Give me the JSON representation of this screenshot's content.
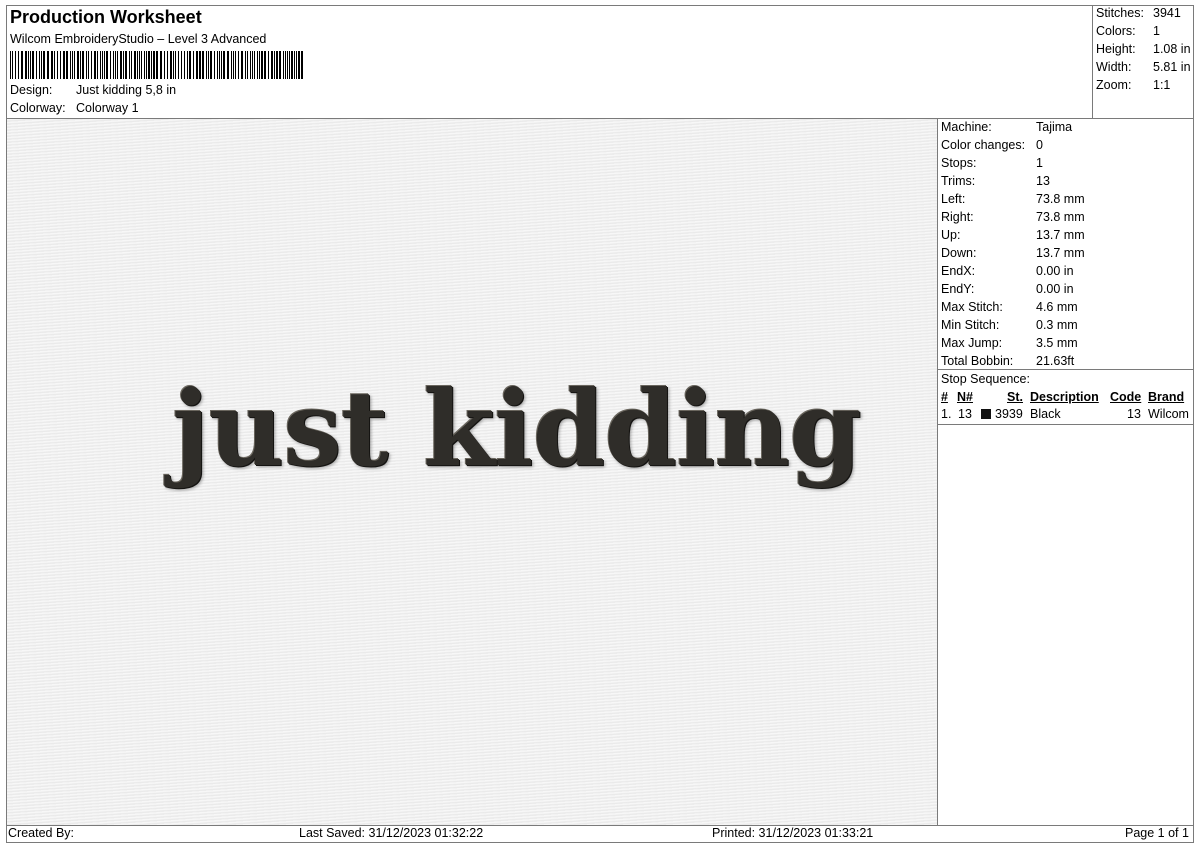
{
  "header": {
    "title": "Production Worksheet",
    "software": "Wilcom EmbroideryStudio – Level 3 Advanced",
    "design_label": "Design:",
    "design_value": "Just kidding 5,8 in",
    "colorway_label": "Colorway:",
    "colorway_value": "Colorway 1"
  },
  "summary": [
    {
      "label": "Stitches:",
      "value": "3941"
    },
    {
      "label": "Colors:",
      "value": "1"
    },
    {
      "label": "Height:",
      "value": "1.08 in"
    },
    {
      "label": "Width:",
      "value": "5.81 in"
    },
    {
      "label": "Zoom:",
      "value": "1:1"
    }
  ],
  "preview": {
    "text": "just kidding",
    "thread_color": "#2f2d29",
    "fabric_color": "#eeeeee"
  },
  "specs": [
    {
      "label": "Machine:",
      "value": "Tajima"
    },
    {
      "label": "Color changes:",
      "value": "0"
    },
    {
      "label": "Stops:",
      "value": "1"
    },
    {
      "label": "Trims:",
      "value": "13"
    },
    {
      "label": "Left:",
      "value": "73.8 mm"
    },
    {
      "label": "Right:",
      "value": "73.8 mm"
    },
    {
      "label": "Up:",
      "value": "13.7 mm"
    },
    {
      "label": "Down:",
      "value": "13.7 mm"
    },
    {
      "label": "EndX:",
      "value": "0.00 in"
    },
    {
      "label": "EndY:",
      "value": "0.00 in"
    },
    {
      "label": "Max Stitch:",
      "value": "4.6 mm"
    },
    {
      "label": "Min Stitch:",
      "value": "0.3 mm"
    },
    {
      "label": "Max Jump:",
      "value": "3.5 mm"
    },
    {
      "label": "Total Bobbin:",
      "value": "21.63ft"
    }
  ],
  "stop_sequence": {
    "title": "Stop Sequence:",
    "headers": {
      "index": "#",
      "n": "N#",
      "st": "St.",
      "description": "Description",
      "code": "Code",
      "brand": "Brand"
    },
    "rows": [
      {
        "index": "1.",
        "n": "13",
        "swatch_color": "#111111",
        "st": "3939",
        "description": "Black",
        "code": "13",
        "brand": "Wilcom"
      }
    ]
  },
  "footer": {
    "created_by": "Created By:",
    "last_saved": "Last Saved: 31/12/2023 01:32:22",
    "printed": "Printed: 31/12/2023 01:33:21",
    "page": "Page 1 of 1"
  }
}
